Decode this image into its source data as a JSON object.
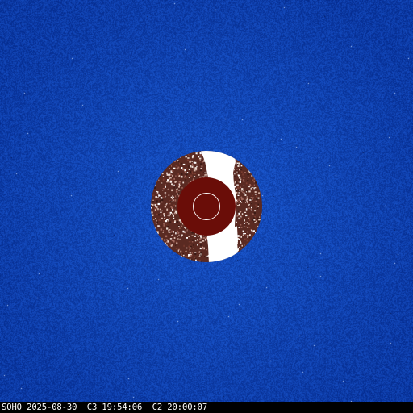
{
  "image": {
    "caption": "SOHO 2025-08-30  C3 19:54:06  C2 20:00:07"
  },
  "colors": {
    "background": "#0b3a9e",
    "occulter_disk": "#6a0d08",
    "caption_bar": "#000000",
    "caption_text": "#ffffff",
    "inner_ring": "#ffffff"
  }
}
